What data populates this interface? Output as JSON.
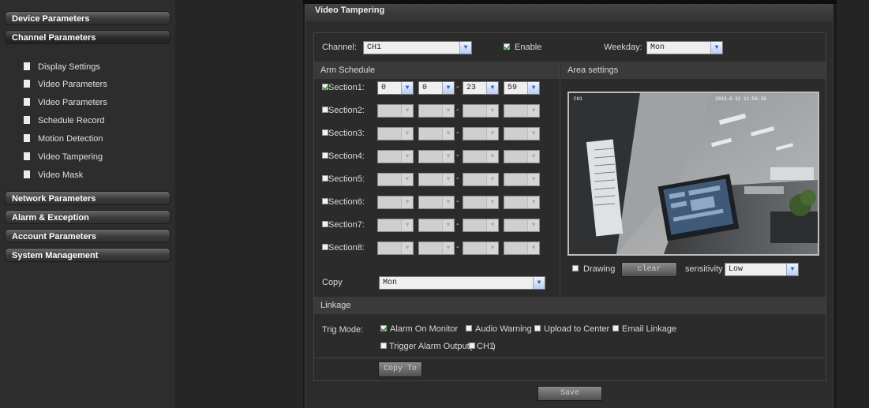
{
  "sidebar": {
    "headers": [
      "Device Parameters",
      "Channel Parameters",
      "Network Parameters",
      "Alarm & Exception",
      "Account Parameters",
      "System Management"
    ],
    "channel_items": [
      "Display Settings",
      "Video Parameters",
      "Video Parameters",
      "Schedule Record",
      "Motion Detection",
      "Video Tampering",
      "Video Mask"
    ]
  },
  "panel": {
    "title": "Video Tampering"
  },
  "channel": {
    "label": "Channel:",
    "value": "CH1"
  },
  "enable": {
    "label": "Enable",
    "checked": true
  },
  "weekday": {
    "label": "Weekday:",
    "value": "Mon"
  },
  "arm_schedule": {
    "title": "Arm Schedule",
    "sections": [
      {
        "label": "Section1:",
        "checked": true,
        "values": [
          "0",
          "0",
          "23",
          "59"
        ]
      },
      {
        "label": "Section2:",
        "checked": false
      },
      {
        "label": "Section3:",
        "checked": false
      },
      {
        "label": "Section4:",
        "checked": false
      },
      {
        "label": "Section5:",
        "checked": false
      },
      {
        "label": "Section6:",
        "checked": false
      },
      {
        "label": "Section7:",
        "checked": false
      },
      {
        "label": "Section8:",
        "checked": false
      }
    ],
    "copy_label": "Copy",
    "copy_value": "Mon"
  },
  "area": {
    "title": "Area settings",
    "video_channel": "CH1",
    "video_timestamp": "2013-6-12 11:56:35",
    "drawing_label": "Drawing",
    "clear_label": "clear",
    "sensitivity_label": "sensitivity",
    "sensitivity_value": "Low"
  },
  "linkage": {
    "title": "Linkage",
    "trig_label": "Trig Mode:",
    "options": [
      {
        "label": "Alarm On Monitor",
        "checked": true
      },
      {
        "label": "Audio Warning",
        "checked": false
      },
      {
        "label": "Upload to Center",
        "checked": false
      },
      {
        "label": "Email Linkage",
        "checked": false
      }
    ],
    "trigger_output_prefix": "Trigger Alarm Output(",
    "trigger_output_channel": "CH1",
    "trigger_output_suffix": ")"
  },
  "buttons": {
    "copy_to": "Copy To",
    "save": "Save"
  }
}
